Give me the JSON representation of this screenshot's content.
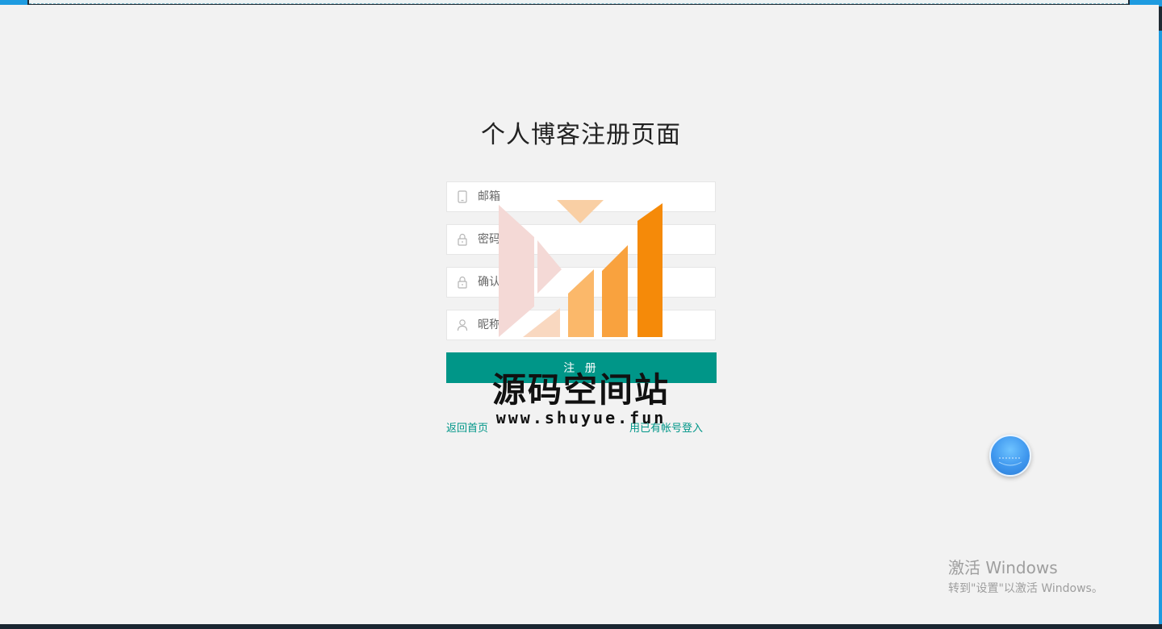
{
  "page": {
    "title": "个人博客注册页面"
  },
  "form": {
    "email_placeholder": "邮箱",
    "password_placeholder": "密码",
    "confirm_placeholder": "确认",
    "nickname_placeholder": "昵称",
    "submit_label": "注 册"
  },
  "links": {
    "back_home": "返回首页",
    "login_existing": "用已有帐号登入"
  },
  "watermark": {
    "title": "源码空间站",
    "url": "www.shuyue.fun"
  },
  "windows_notice": {
    "headline": "激活 Windows",
    "subline": "转到\"设置\"以激活 Windows。"
  },
  "colors": {
    "accent": "#009688",
    "background": "#f2f2f2",
    "frame_blue": "#1e9be0"
  },
  "icons": [
    "phone-icon",
    "lock-icon",
    "lock-icon",
    "user-icon",
    "floating-assistant-icon"
  ]
}
